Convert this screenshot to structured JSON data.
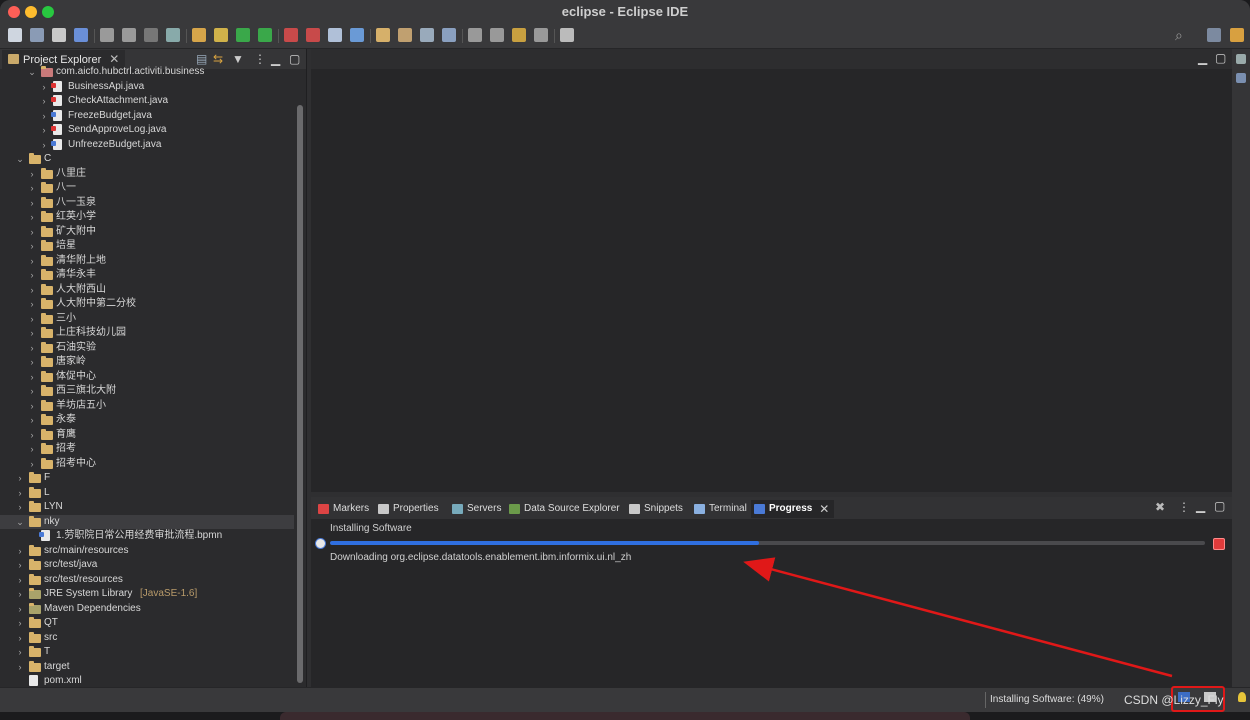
{
  "window": {
    "title": "eclipse - Eclipse IDE"
  },
  "project_explorer": {
    "tab_label": "Project Explorer",
    "rows": [
      {
        "label": "com.aicfo.hubctrl.activiti.business",
        "kind": "pkg"
      },
      {
        "label": "BusinessApi.java",
        "kind": "java-red"
      },
      {
        "label": "CheckAttachment.java",
        "kind": "java-red"
      },
      {
        "label": "FreezeBudget.java",
        "kind": "java"
      },
      {
        "label": "SendApproveLog.java",
        "kind": "java-red"
      },
      {
        "label": "UnfreezeBudget.java",
        "kind": "java"
      },
      {
        "label": "C",
        "kind": "folder"
      },
      {
        "label": "八里庄",
        "kind": "folder"
      },
      {
        "label": "八一",
        "kind": "folder"
      },
      {
        "label": "八一玉泉",
        "kind": "folder"
      },
      {
        "label": "红英小学",
        "kind": "folder"
      },
      {
        "label": "矿大附中",
        "kind": "folder"
      },
      {
        "label": "培星",
        "kind": "folder"
      },
      {
        "label": "清华附上地",
        "kind": "folder"
      },
      {
        "label": "清华永丰",
        "kind": "folder"
      },
      {
        "label": "人大附西山",
        "kind": "folder"
      },
      {
        "label": "人大附中第二分校",
        "kind": "folder"
      },
      {
        "label": "三小",
        "kind": "folder"
      },
      {
        "label": "上庄科技幼儿园",
        "kind": "folder"
      },
      {
        "label": "石油实验",
        "kind": "folder"
      },
      {
        "label": "唐家岭",
        "kind": "folder"
      },
      {
        "label": "体促中心",
        "kind": "folder"
      },
      {
        "label": "西三旗北大附",
        "kind": "folder"
      },
      {
        "label": "羊坊店五小",
        "kind": "folder"
      },
      {
        "label": "永泰",
        "kind": "folder"
      },
      {
        "label": "育鹰",
        "kind": "folder"
      },
      {
        "label": "招考",
        "kind": "folder"
      },
      {
        "label": "招考中心",
        "kind": "folder"
      },
      {
        "label": "F",
        "kind": "folder"
      },
      {
        "label": "L",
        "kind": "folder"
      },
      {
        "label": "LYN",
        "kind": "folder"
      },
      {
        "label": "nky",
        "kind": "folder"
      },
      {
        "label": "1.劳职院日常公用经费审批流程.bpmn",
        "kind": "bpmn"
      },
      {
        "label": "src/main/resources",
        "kind": "folder"
      },
      {
        "label": "src/test/java",
        "kind": "folder"
      },
      {
        "label": "src/test/resources",
        "kind": "folder"
      },
      {
        "label": "JRE System Library",
        "suffix": "[JavaSE-1.6]",
        "kind": "lib"
      },
      {
        "label": "Maven Dependencies",
        "kind": "lib"
      },
      {
        "label": "QT",
        "kind": "folder"
      },
      {
        "label": "src",
        "kind": "folder"
      },
      {
        "label": "T",
        "kind": "folder"
      },
      {
        "label": "target",
        "kind": "folder"
      },
      {
        "label": "pom.xml",
        "kind": "file"
      }
    ]
  },
  "bottom_panel": {
    "tabs": [
      "Markers",
      "Properties",
      "Servers",
      "Data Source Explorer",
      "Snippets",
      "Terminal",
      "Progress"
    ],
    "active_tab": "Progress",
    "progress": {
      "job_title": "Installing Software",
      "detail": "Downloading org.eclipse.datatools.enablement.ibm.informix.ui.nl_zh",
      "fraction": 0.49
    }
  },
  "status_bar": {
    "text": "Installing Software: (49%)"
  },
  "watermark": "CSDN @Lizzy_Fly",
  "colors": {
    "accent": "#2f6fe0",
    "annotation_red": "#e01818"
  }
}
